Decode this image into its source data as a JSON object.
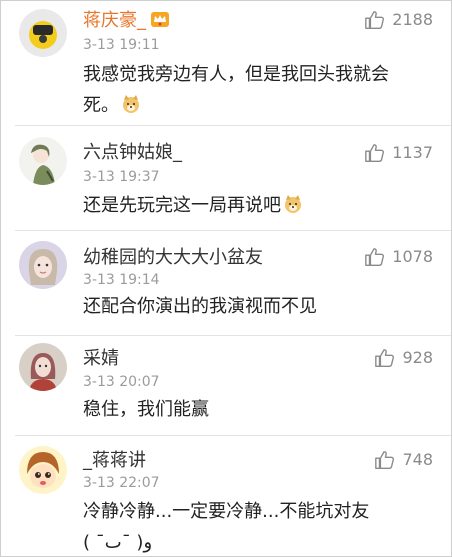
{
  "colors": {
    "username": "#333333",
    "username_vip": "#e8772e",
    "meta": "#9b9b9b",
    "like": "#8a8a8a",
    "divider": "#e3e3e3"
  },
  "comments": [
    {
      "username": "蒋庆豪_",
      "badge_icon": "crown-vip-icon",
      "time": "3-13 19:11",
      "likes": "2188",
      "line1": "我感觉我旁边有人，但是我回头我就会",
      "line2": "死。",
      "emoji_icon": "doge-emoji-icon"
    },
    {
      "username": "六点钟姑娘_",
      "time": "3-13 19:37",
      "likes": "1137",
      "line1": "还是先玩完这一局再说吧",
      "emoji_icon": "doge-emoji-icon"
    },
    {
      "username": "幼稚园的大大大小盆友",
      "time": "3-13 19:14",
      "likes": "1078",
      "line1": "还配合你演出的我演视而不见"
    },
    {
      "username": "采婧",
      "time": "3-13 20:07",
      "likes": "928",
      "line1": "稳住，我们能赢"
    },
    {
      "username": "_蒋蒋讲",
      "time": "3-13 22:07",
      "likes": "748",
      "line1": "冷静冷静...一定要冷静...不能坑对友",
      "line2": "( ¯ٮ¯ )و"
    }
  ]
}
